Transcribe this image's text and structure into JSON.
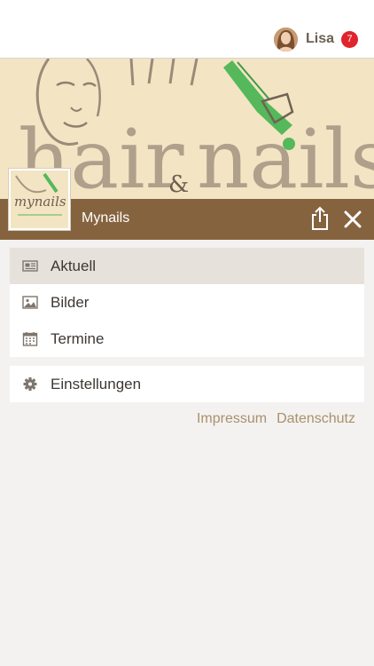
{
  "user": {
    "name": "Lisa",
    "notifications": "7"
  },
  "header": {
    "title": "Mynails"
  },
  "menu_main": [
    {
      "label": "Aktuell",
      "icon": "newspaper-icon",
      "active": true
    },
    {
      "label": "Bilder",
      "icon": "image-icon",
      "active": false
    },
    {
      "label": "Termine",
      "icon": "calendar-icon",
      "active": false
    }
  ],
  "menu_settings": [
    {
      "label": "Einstellungen",
      "icon": "gear-icon"
    }
  ],
  "footer": {
    "impressum": "Impressum",
    "datenschutz": "Datenschutz"
  },
  "banner": {
    "logo_text": "hair & nails",
    "thumb_text": "mynails"
  },
  "colors": {
    "brand_brown": "#86633f",
    "banner_bg": "#f3e4c4",
    "accent_green": "#55b85a",
    "badge_red": "#e0242b",
    "link_tan": "#ab906e"
  }
}
